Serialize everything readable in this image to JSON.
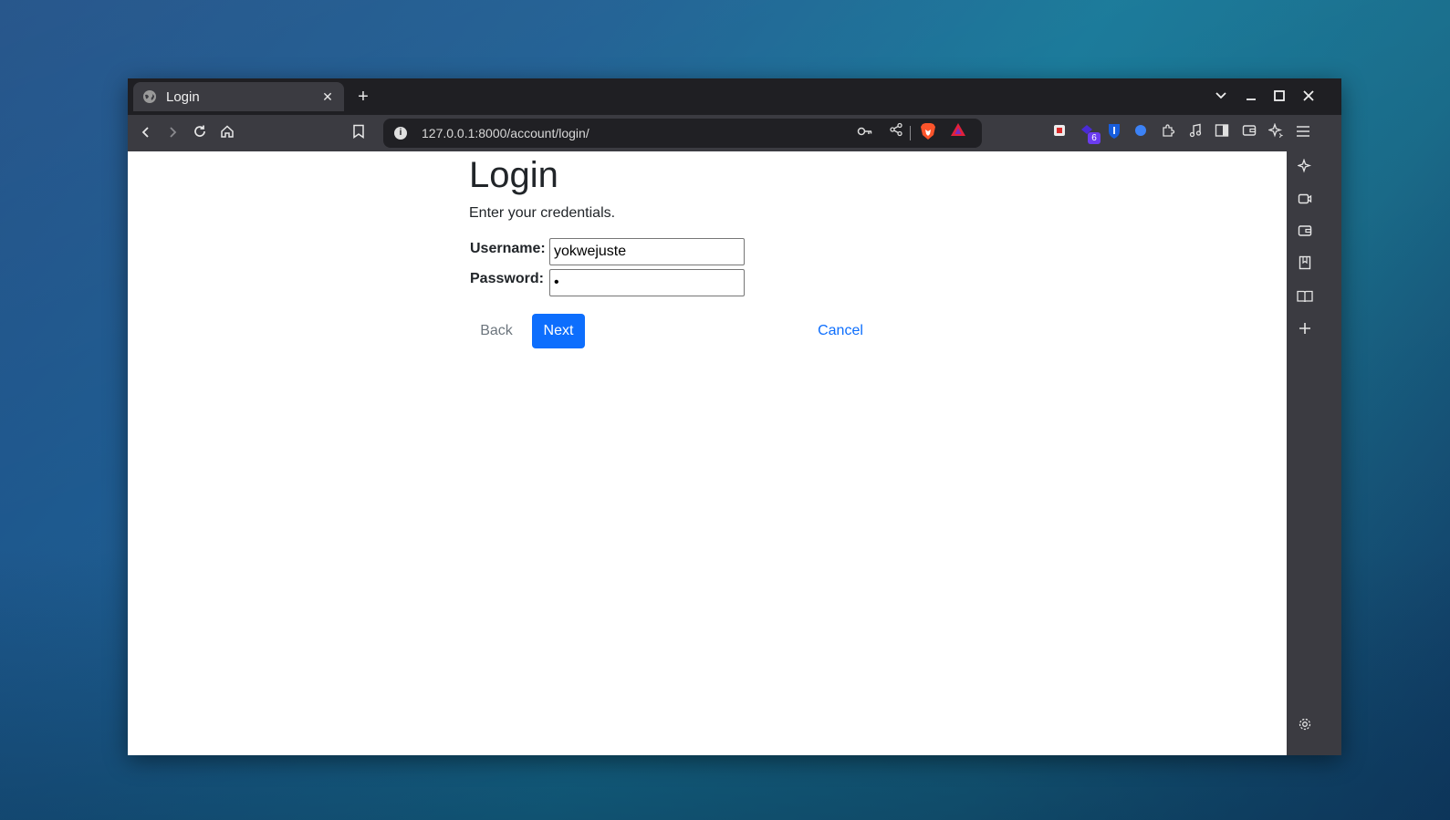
{
  "browser": {
    "tab_title": "Login",
    "url": "127.0.0.1:8000/account/login/",
    "extension_badge_count": "6",
    "icons": {
      "tab_favicon": "globe-icon",
      "tab_close": "close-icon",
      "new_tab": "plus-icon",
      "tab_list": "chevron-down-icon",
      "minimize": "minimize-icon",
      "maximize": "maximize-icon",
      "window_close": "close-icon",
      "back": "back-arrow-icon",
      "forward": "forward-arrow-icon",
      "reload": "reload-icon",
      "home": "home-icon",
      "bookmark": "bookmark-icon",
      "site_info": "info-icon",
      "password_key": "key-icon",
      "share": "share-icon",
      "brave_shields": "brave-lion-icon",
      "brave_rewards": "triangle-icon",
      "menu": "hamburger-menu-icon"
    }
  },
  "page": {
    "heading": "Login",
    "subtitle": "Enter your credentials.",
    "username_label": "Username:",
    "username_value": "yokwejuste",
    "password_label": "Password:",
    "password_value": "•",
    "back_label": "Back",
    "next_label": "Next",
    "cancel_label": "Cancel"
  },
  "colors": {
    "primary": "#0d6efd",
    "secondary": "#6c757d",
    "browser_chrome": "#3b3b41",
    "tabbar": "#1f1f23"
  }
}
